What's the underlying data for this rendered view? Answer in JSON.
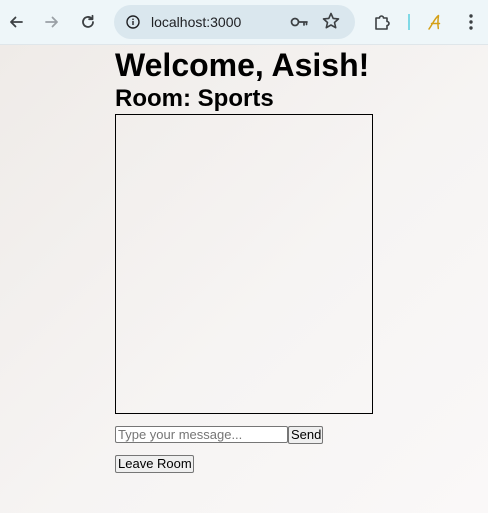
{
  "browser": {
    "url": "localhost:3000",
    "icons": {
      "back": "arrow-left-icon",
      "forward": "arrow-right-icon",
      "reload": "reload-icon",
      "site_info": "info-icon",
      "password": "key-icon",
      "bookmark": "star-icon",
      "extensions": "puzzle-icon",
      "profile": "script-a-icon",
      "menu": "kebab-menu-icon"
    },
    "colors": {
      "toolbar": "#eef6f9",
      "omnibox": "#dae7ee",
      "profile_accent": "#d4a017"
    }
  },
  "page": {
    "welcome_heading": "Welcome, Asish!",
    "room_heading": "Room: Sports",
    "chat": {
      "messages": []
    },
    "message_input": {
      "placeholder": "Type your message...",
      "value": ""
    },
    "send_label": "Send",
    "leave_label": "Leave Room"
  }
}
